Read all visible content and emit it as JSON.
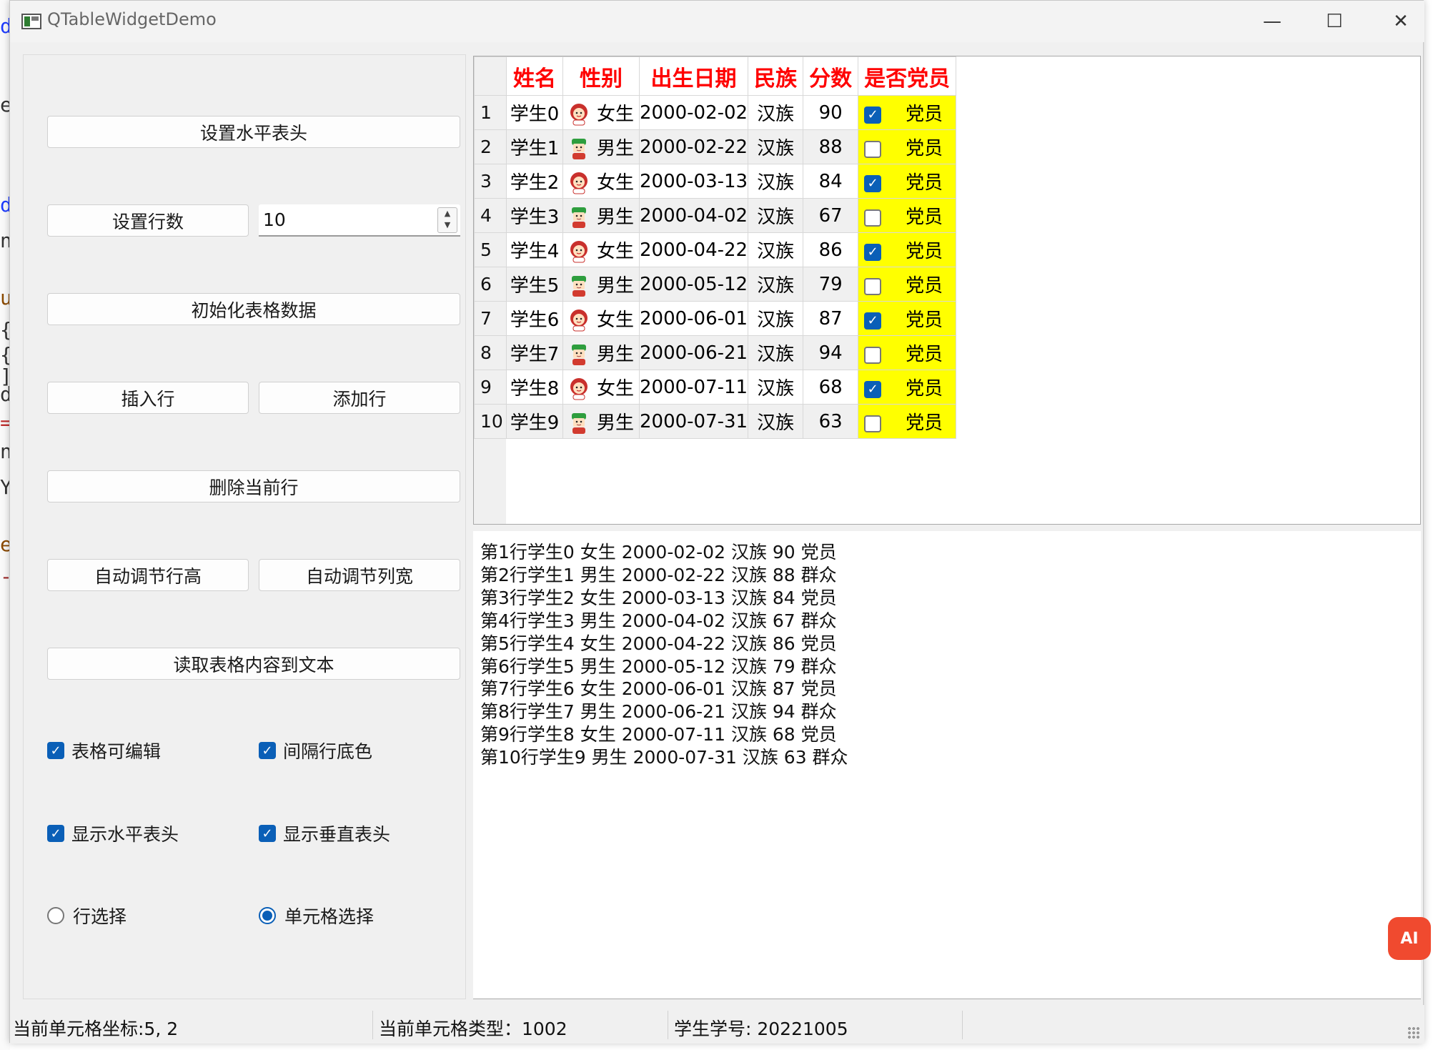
{
  "window": {
    "title": "QTableWidgetDemo",
    "minimize": "—",
    "maximize": "☐",
    "close": "✕"
  },
  "background_fragments": [
    "d",
    "e",
    "d",
    "n",
    "u",
    "{",
    "{",
    "]",
    "d",
    "=",
    "n",
    "Y",
    "e",
    "->"
  ],
  "left": {
    "btn_set_header": "设置水平表头",
    "btn_set_rows": "设置行数",
    "row_count": "10",
    "btn_init": "初始化表格数据",
    "btn_insert": "插入行",
    "btn_add": "添加行",
    "btn_delete": "删除当前行",
    "btn_auto_height": "自动调节行高",
    "btn_auto_width": "自动调节列宽",
    "btn_read": "读取表格内容到文本",
    "chk_editable": "表格可编辑",
    "chk_alt_color": "间隔行底色",
    "chk_show_h": "显示水平表头",
    "chk_show_v": "显示垂直表头",
    "radio_row": "行选择",
    "radio_cell": "单元格选择"
  },
  "table": {
    "headers": [
      "姓名",
      "性别",
      "出生日期",
      "民族",
      "分数",
      "是否党员"
    ],
    "rows": [
      {
        "num": "1",
        "name": "学生0",
        "gender": "女生",
        "date": "2000-02-02",
        "nation": "汉族",
        "score": "90",
        "party": "党员",
        "checked": true
      },
      {
        "num": "2",
        "name": "学生1",
        "gender": "男生",
        "date": "2000-02-22",
        "nation": "汉族",
        "score": "88",
        "party": "党员",
        "checked": false
      },
      {
        "num": "3",
        "name": "学生2",
        "gender": "女生",
        "date": "2000-03-13",
        "nation": "汉族",
        "score": "84",
        "party": "党员",
        "checked": true
      },
      {
        "num": "4",
        "name": "学生3",
        "gender": "男生",
        "date": "2000-04-02",
        "nation": "汉族",
        "score": "67",
        "party": "党员",
        "checked": false
      },
      {
        "num": "5",
        "name": "学生4",
        "gender": "女生",
        "date": "2000-04-22",
        "nation": "汉族",
        "score": "86",
        "party": "党员",
        "checked": true
      },
      {
        "num": "6",
        "name": "学生5",
        "gender": "男生",
        "date": "2000-05-12",
        "nation": "汉族",
        "score": "79",
        "party": "党员",
        "checked": false
      },
      {
        "num": "7",
        "name": "学生6",
        "gender": "女生",
        "date": "2000-06-01",
        "nation": "汉族",
        "score": "87",
        "party": "党员",
        "checked": true
      },
      {
        "num": "8",
        "name": "学生7",
        "gender": "男生",
        "date": "2000-06-21",
        "nation": "汉族",
        "score": "94",
        "party": "党员",
        "checked": false
      },
      {
        "num": "9",
        "name": "学生8",
        "gender": "女生",
        "date": "2000-07-11",
        "nation": "汉族",
        "score": "68",
        "party": "党员",
        "checked": true
      },
      {
        "num": "10",
        "name": "学生9",
        "gender": "男生",
        "date": "2000-07-31",
        "nation": "汉族",
        "score": "63",
        "party": "党员",
        "checked": false
      }
    ]
  },
  "text_lines": [
    "第1行学生0 女生 2000-02-02 汉族 90 党员",
    "第2行学生1 男生 2000-02-22 汉族 88 群众",
    "第3行学生2 女生 2000-03-13 汉族 84 党员",
    "第4行学生3 男生 2000-04-02 汉族 67 群众",
    "第5行学生4 女生 2000-04-22 汉族 86 党员",
    "第6行学生5 男生 2000-05-12 汉族 79 群众",
    "第7行学生6 女生 2000-06-01 汉族 87 党员",
    "第8行学生7 男生 2000-06-21 汉族 94 群众",
    "第9行学生8 女生 2000-07-11 汉族 68 党员",
    "第10行学生9 男生 2000-07-31 汉族 63 群众"
  ],
  "ai_button": "AI",
  "status": {
    "coord": "当前单元格坐标:5, 2",
    "type": "当前单元格类型：1002",
    "student_id": "学生学号: 20221005"
  },
  "colors": {
    "header_text": "#ff0000",
    "party_bg": "#ffff00",
    "accent": "#0a5fb7",
    "ai": "#f04a2f"
  },
  "icons": {
    "female": "female-avatar-icon",
    "male": "male-avatar-icon"
  }
}
